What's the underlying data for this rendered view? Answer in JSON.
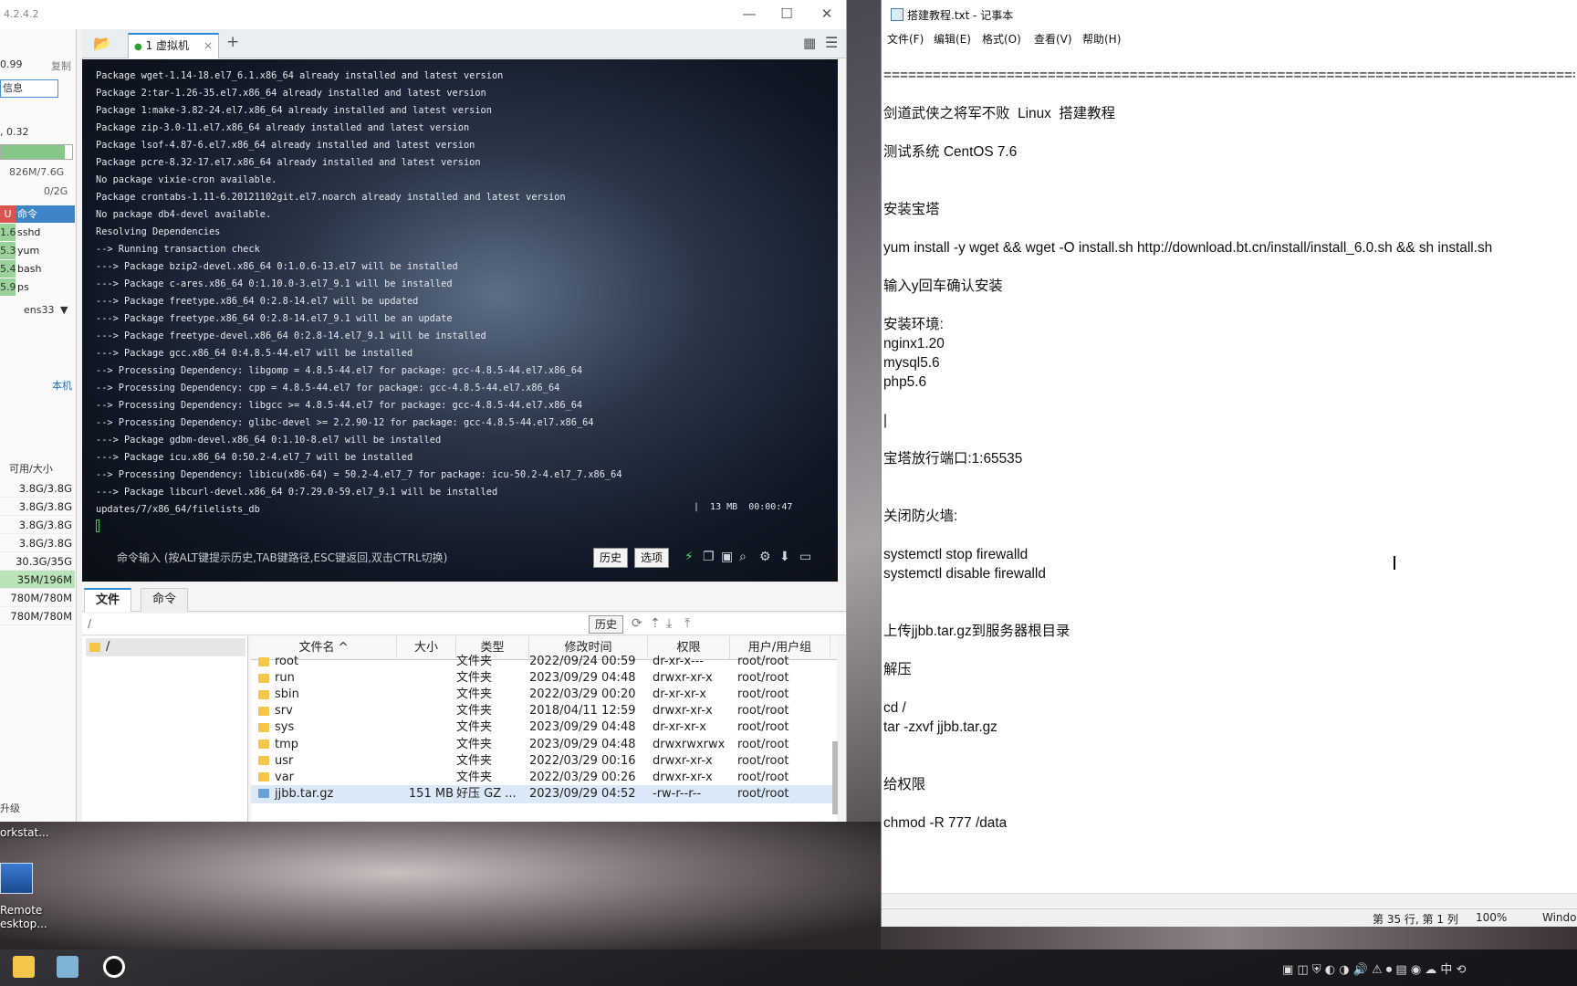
{
  "finalshell": {
    "version": "4.2.4.2",
    "window_buttons": [
      "—",
      "☐",
      "✕"
    ],
    "left_panel": {
      "ip_value": "0.99",
      "copy_label": "复制",
      "info_label": "信息",
      "load_text": ", 0.32",
      "memory_text": "826M/7.6G",
      "memory_percent": 95,
      "swap_text": "0/2G",
      "proc_header_cpu": "U",
      "proc_header_label": "命令",
      "processes": [
        {
          "cpu": "1.6",
          "name": "sshd"
        },
        {
          "cpu": "5.3",
          "name": "yum"
        },
        {
          "cpu": "5.4",
          "name": "bash"
        },
        {
          "cpu": "5.9",
          "name": "ps"
        }
      ],
      "net_iface": "ens33",
      "local_label": "本机",
      "disk_header": "可用/大小",
      "disks": [
        "3.8G/3.8G",
        "3.8G/3.8G",
        "3.8G/3.8G",
        "3.8G/3.8G",
        "30.3G/35G",
        "35M/196M",
        "780M/780M",
        "780M/780M"
      ],
      "upgrade_label": "升级"
    },
    "tab": {
      "label": "1 虚拟机",
      "close": "×",
      "add": "+"
    },
    "terminal": {
      "lines": [
        "Package wget-1.14-18.el7_6.1.x86_64 already installed and latest version",
        "Package 2:tar-1.26-35.el7.x86_64 already installed and latest version",
        "Package 1:make-3.82-24.el7.x86_64 already installed and latest version",
        "Package zip-3.0-11.el7.x86_64 already installed and latest version",
        "Package lsof-4.87-6.el7.x86_64 already installed and latest version",
        "Package pcre-8.32-17.el7.x86_64 already installed and latest version",
        "No package vixie-cron available.",
        "Package crontabs-1.11-6.20121102git.el7.noarch already installed and latest version",
        "No package db4-devel available.",
        "Resolving Dependencies",
        "--> Running transaction check",
        "---> Package bzip2-devel.x86_64 0:1.0.6-13.el7 will be installed",
        "---> Package c-ares.x86_64 0:1.10.0-3.el7_9.1 will be installed",
        "---> Package freetype.x86_64 0:2.8-14.el7 will be updated",
        "---> Package freetype.x86_64 0:2.8-14.el7_9.1 will be an update",
        "---> Package freetype-devel.x86_64 0:2.8-14.el7_9.1 will be installed",
        "---> Package gcc.x86_64 0:4.8.5-44.el7 will be installed",
        "--> Processing Dependency: libgomp = 4.8.5-44.el7 for package: gcc-4.8.5-44.el7.x86_64",
        "--> Processing Dependency: cpp = 4.8.5-44.el7 for package: gcc-4.8.5-44.el7.x86_64",
        "--> Processing Dependency: libgcc >= 4.8.5-44.el7 for package: gcc-4.8.5-44.el7.x86_64",
        "--> Processing Dependency: glibc-devel >= 2.2.90-12 for package: gcc-4.8.5-44.el7.x86_64",
        "---> Package gdbm-devel.x86_64 0:1.10-8.el7 will be installed",
        "---> Package icu.x86_64 0:50.2-4.el7_7 will be installed",
        "--> Processing Dependency: libicu(x86-64) = 50.2-4.el7_7 for package: icu-50.2-4.el7_7.x86_64",
        "---> Package libcurl-devel.x86_64 0:7.29.0-59.el7_9.1 will be installed",
        "updates/7/x86_64/filelists_db"
      ],
      "status": "|  13 MB  00:00:47",
      "input_hint": "命令输入 (按ALT键提示历史,TAB键路径,ESC键返回,双击CTRL切换)",
      "history_btn": "历史",
      "options_btn": "选项"
    },
    "bottom_tabs": [
      "文件",
      "命令"
    ],
    "path": "/",
    "history_btn2": "历史",
    "tree_root": "/",
    "file_headers": [
      "文件名 ^",
      "大小",
      "类型",
      "修改时间",
      "权限",
      "用户/用户组"
    ],
    "files": [
      {
        "name": "root",
        "size": "",
        "type": "文件夹",
        "mtime": "2022/09/24 00:59",
        "perm": "dr-xr-x---",
        "owner": "root/root"
      },
      {
        "name": "run",
        "size": "",
        "type": "文件夹",
        "mtime": "2023/09/29 04:48",
        "perm": "drwxr-xr-x",
        "owner": "root/root"
      },
      {
        "name": "sbin",
        "size": "",
        "type": "文件夹",
        "mtime": "2022/03/29 00:20",
        "perm": "dr-xr-xr-x",
        "owner": "root/root"
      },
      {
        "name": "srv",
        "size": "",
        "type": "文件夹",
        "mtime": "2018/04/11 12:59",
        "perm": "drwxr-xr-x",
        "owner": "root/root"
      },
      {
        "name": "sys",
        "size": "",
        "type": "文件夹",
        "mtime": "2023/09/29 04:48",
        "perm": "dr-xr-xr-x",
        "owner": "root/root"
      },
      {
        "name": "tmp",
        "size": "",
        "type": "文件夹",
        "mtime": "2023/09/29 04:48",
        "perm": "drwxrwxrwx",
        "owner": "root/root"
      },
      {
        "name": "usr",
        "size": "",
        "type": "文件夹",
        "mtime": "2022/03/29 00:16",
        "perm": "drwxr-xr-x",
        "owner": "root/root"
      },
      {
        "name": "var",
        "size": "",
        "type": "文件夹",
        "mtime": "2022/03/29 00:26",
        "perm": "drwxr-xr-x",
        "owner": "root/root"
      },
      {
        "name": "jjbb.tar.gz",
        "size": "151 MB",
        "type": "好压 GZ ...",
        "mtime": "2023/09/29 04:52",
        "perm": "-rw-r--r--",
        "owner": "root/root"
      }
    ]
  },
  "notepad": {
    "title": "搭建教程.txt - 记事本",
    "menu": [
      "文件(F)",
      "编辑(E)",
      "格式(O)",
      "查看(V)",
      "帮助(H)"
    ],
    "text": "=====================================================================================\n\n剑道武侠之将军不败  Linux  搭建教程\n\n测试系统 CentOS 7.6\n\n\n安装宝塔\n\nyum install -y wget && wget -O install.sh http://download.bt.cn/install/install_6.0.sh && sh install.sh\n\n输入y回车确认安装\n\n安装环境:\nnginx1.20\nmysql5.6\nphp5.6\n\n|\n\n宝塔放行端口:1:65535\n\n\n关闭防火墙:\n\nsystemctl stop firewalld\nsystemctl disable firewalld\n\n\n上传jjbb.tar.gz到服务器根目录\n\n解压\n\ncd /\ntar -zxvf jjbb.tar.gz\n\n\n给权限\n\nchmod -R 777 /data",
    "status_pos": "第 35 行, 第 1 列",
    "status_zoom": "100%",
    "status_eol": "Windo"
  },
  "desktop": {
    "label1": "orkstat...",
    "remote_label": "Remote\nesktop..."
  },
  "colors": {
    "accent": "#2a8ad4",
    "terminal_text": "#e4e8ee",
    "selected_row": "#dbe8f7"
  }
}
